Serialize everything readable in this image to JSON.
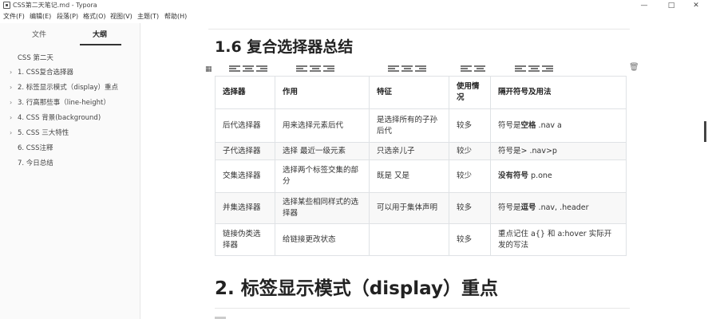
{
  "window": {
    "title": "CSS第二天笔记.md - Typora",
    "minimize": "—",
    "maximize": "□",
    "close": "✕"
  },
  "menu": [
    "文件(F)",
    "编辑(E)",
    "段落(P)",
    "格式(O)",
    "视图(V)",
    "主题(T)",
    "帮助(H)"
  ],
  "sidebar": {
    "tabs": [
      {
        "label": "文件",
        "active": false
      },
      {
        "label": "大纲",
        "active": true
      }
    ],
    "outline": [
      {
        "label": "CSS 第二天",
        "level": 0,
        "expandable": false
      },
      {
        "label": "1. CSS复合选择器",
        "level": 1,
        "expandable": true
      },
      {
        "label": "2. 标签显示模式（display）重点",
        "level": 1,
        "expandable": true
      },
      {
        "label": "3. 行高那些事（line-height）",
        "level": 1,
        "expandable": true
      },
      {
        "label": "4. CSS 背景(background)",
        "level": 1,
        "expandable": true
      },
      {
        "label": "5. CSS 三大特性",
        "level": 1,
        "expandable": true
      },
      {
        "label": "6. CSS注释",
        "level": 1,
        "expandable": false
      },
      {
        "label": "7. 今日总结",
        "level": 1,
        "expandable": false
      }
    ],
    "caret_glyph": "›"
  },
  "document": {
    "heading1": "1.6 复合选择器总结",
    "heading2": "2. 标签显示模式（display）重点",
    "table": {
      "headers": [
        "选择器",
        "作用",
        "特征",
        "使用情况",
        "隔开符号及用法"
      ],
      "rows": [
        [
          "后代选择器",
          "用来选择元素后代",
          "是选择所有的子孙后代",
          "较多",
          ""
        ],
        [
          "子代选择器",
          "选择 最近一级元素",
          "只选亲儿子",
          "较少",
          "符号是> .nav>p"
        ],
        [
          "交集选择器",
          "选择两个标签交集的部分",
          "既是 又是",
          "较少",
          ""
        ],
        [
          "并集选择器",
          "选择某些相同样式的选择器",
          "可以用于集体声明",
          "较多",
          ""
        ],
        [
          "链接伪类选择器",
          "给链接更改状态",
          "",
          "较多",
          "重点记住 a{} 和 a:hover 实际开发的写法"
        ]
      ],
      "rich_cells": {
        "r0": {
          "prefix": "符号是",
          "bold": "空格",
          "suffix": " .nav a"
        },
        "r2": {
          "prefix": "",
          "bold": "没有符号",
          "suffix": " p.one"
        },
        "r3": {
          "prefix": "符号是",
          "bold": "逗号",
          "suffix": " .nav, .header"
        }
      }
    },
    "toolbar": {
      "table_menu_icon": "▦",
      "delete_icon": "🗑"
    }
  }
}
